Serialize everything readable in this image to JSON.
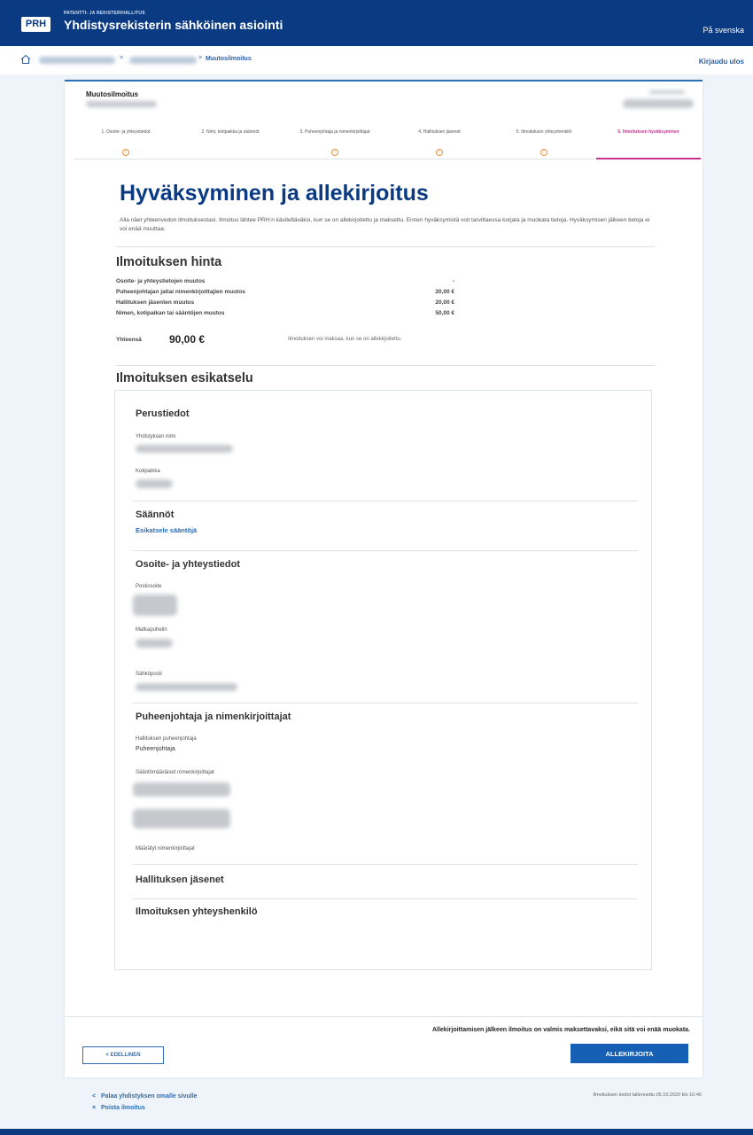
{
  "header": {
    "org_subtitle": "PATENTTI- JA REKISTERIHALLITUS",
    "logo_text": "PRH",
    "app_title": "Yhdistysrekisterin sähköinen asiointi",
    "language_link": "På svenska"
  },
  "breadcrumb": {
    "separator": ">",
    "current": "Muutosilmoitus",
    "logout": "Kirjaudu ulos"
  },
  "form": {
    "title": "Muutosilmoitus"
  },
  "steps": [
    {
      "label": "1. Osoite- ja yhteystiedot",
      "active": false
    },
    {
      "label": "2. Nimi, kotipaikka ja säännöt",
      "active": false
    },
    {
      "label": "3. Puheenjohtaja ja nimenkirjoittajat",
      "active": false
    },
    {
      "label": "4. Hallituksen jäsenet",
      "active": false
    },
    {
      "label": "5. Ilmoituksen yhteyshenkilö",
      "active": false
    },
    {
      "label": "6. Ilmoituksen hyväksyminen",
      "active": true
    }
  ],
  "main": {
    "heading": "Hyväksyminen ja allekirjoitus",
    "intro": "Alla näet yhteenvedon ilmoituksestasi. Ilmoitus lähtee PRH:n käsiteltäväksi, kun se on allekirjoitettu ja maksettu. Ennen hyväksymistä voit tarvittaessa korjata ja muokata tietoja. Hyväksymisen jälkeen tietoja ei voi enää muuttaa."
  },
  "price": {
    "heading": "Ilmoituksen hinta",
    "rows": [
      {
        "label": "Osoite- ja yhteystietojen muutos",
        "amount": "-"
      },
      {
        "label": "Puheenjohtajan jaitai nimenkirjoittajien muutos",
        "amount": "20,00 €"
      },
      {
        "label": "Hallituksen jäsenten muutos",
        "amount": "20,00 €"
      },
      {
        "label": "Nimen, kotipaikan tai sääntöjen muutos",
        "amount": "50,00 €"
      }
    ],
    "total_label": "Yhteensä",
    "total_value": "90,00 €",
    "total_note": "Ilmoituksen voi maksaa, kun se on allekirjoitettu."
  },
  "preview": {
    "heading": "Ilmoituksen esikatselu",
    "basic": {
      "title": "Perustiedot",
      "name_label": "Yhdistyksen nimi",
      "home_label": "Kotipaikka"
    },
    "rules": {
      "title": "Säännöt",
      "link": "Esikatsele sääntöjä"
    },
    "contact": {
      "title": "Osoite- ja yhteystiedot",
      "postal_label": "Postiosoite",
      "phone_label": "Matkapuhelin",
      "email_label": "Sähköposti"
    },
    "chair": {
      "title": "Puheenjohtaja ja nimenkirjoittajat",
      "chair_label": "Hallituksen puheenjohtaja",
      "chair_value": "Puheenjohtaja",
      "signers_label": "Sääntömääräiset nimenkirjoittajat",
      "appointed_label": "Määrätyt nimenkirjoittajat"
    },
    "board_title": "Hallituksen jäsenet",
    "contact_person_title": "Ilmoituksen yhteyshenkilö"
  },
  "actions": {
    "sign_note": "Allekirjoittamisen jälkeen ilmoitus on valmis maksettavaksi, eikä sitä voi enää muokata.",
    "prev_label": "< EDELLINEN",
    "sign_label": "ALLEKIRJOITA"
  },
  "footer": {
    "back_link": "Palaa yhdistyksen omalle sivulle",
    "back_icon": "<",
    "delete_link": "Poista ilmoitus",
    "delete_icon": "×",
    "saved_note": "Ilmoituksen tiedot tallennettu 05.10.2020 klo 10:46"
  },
  "colors": {
    "brand_blue": "#0a3a82",
    "link_blue": "#2a6db5",
    "active_step": "#c7378f",
    "step_icon": "#e9923f"
  }
}
